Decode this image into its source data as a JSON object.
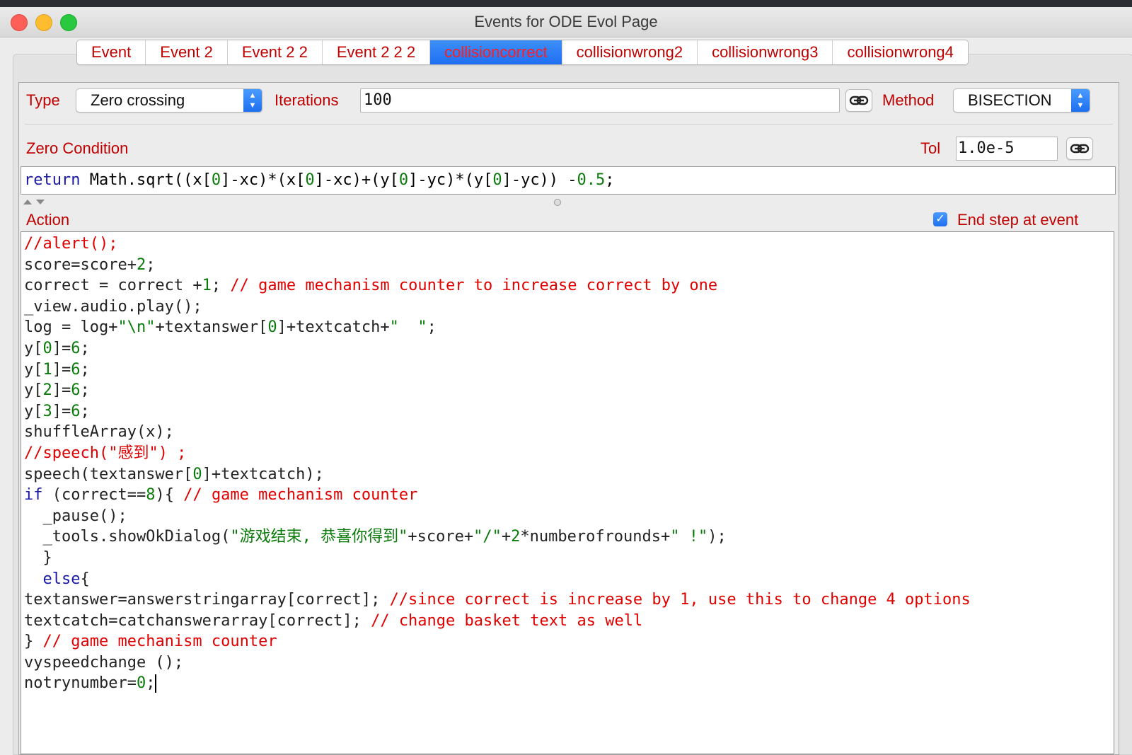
{
  "window": {
    "title": "Events for ODE Evol Page"
  },
  "tabs": [
    {
      "label": "Event",
      "active": false
    },
    {
      "label": "Event 2",
      "active": false
    },
    {
      "label": "Event 2 2",
      "active": false
    },
    {
      "label": "Event 2 2 2",
      "active": false
    },
    {
      "label": "collisioncorrect",
      "active": true
    },
    {
      "label": "collisionwrong2",
      "active": false
    },
    {
      "label": "collisionwrong3",
      "active": false
    },
    {
      "label": "collisionwrong4",
      "active": false
    }
  ],
  "form": {
    "type_label": "Type",
    "type_value": "Zero crossing",
    "iterations_label": "Iterations",
    "iterations_value": "100",
    "method_label": "Method",
    "method_value": "BISECTION",
    "zero_condition_label": "Zero Condition",
    "tol_label": "Tol",
    "tol_value": "1.0e-5",
    "zero_condition": {
      "keyword": "return",
      "p1": " Math.sqrt((x[",
      "n1": "0",
      "p2": "]-xc)*(x[",
      "n2": "0",
      "p3": "]-xc)+(y[",
      "n3": "0",
      "p4": "]-yc)*(y[",
      "n4": "0",
      "p5": "]-yc)) -",
      "n5": "0.5",
      "p6": ";"
    },
    "action_label": "Action",
    "end_step_label": "End step at event",
    "end_step_checked": true
  },
  "action_code": {
    "l1_c": "//alert();",
    "l2_a": "score=score+",
    "l2_n": "2",
    "l2_b": ";",
    "l3_a": "correct = correct +",
    "l3_n": "1",
    "l3_b": "; ",
    "l3_c": "// game mechanism counter to increase correct by one",
    "l4": "_view.audio.play();",
    "l5_a": "log = log+",
    "l5_s1": "\"\\n\"",
    "l5_b": "+textanswer[",
    "l5_n": "0",
    "l5_c": "]+textcatch+",
    "l5_s2": "\"  \"",
    "l5_d": ";",
    "l6_a": "y[",
    "l6_i": "0",
    "l6_b": "]=",
    "l6_v": "6",
    "l6_e": ";",
    "l7_a": "y[",
    "l7_i": "1",
    "l7_b": "]=",
    "l7_v": "6",
    "l7_e": ";",
    "l8_a": "y[",
    "l8_i": "2",
    "l8_b": "]=",
    "l8_v": "6",
    "l8_e": ";",
    "l9_a": "y[",
    "l9_i": "3",
    "l9_b": "]=",
    "l9_v": "6",
    "l9_e": ";",
    "l10": "shuffleArray(x);",
    "l11_c": "//speech(\"感到\") ;",
    "l12_a": "speech(textanswer[",
    "l12_n": "0",
    "l12_b": "]+textcatch);",
    "l13_k": "if",
    "l13_a": " (correct==",
    "l13_n": "8",
    "l13_b": "){ ",
    "l13_c": "// game mechanism counter",
    "l14": "  _pause();",
    "l15_a": "  _tools.showOkDialog(",
    "l15_s1": "\"游戏结束, 恭喜你得到\"",
    "l15_b": "+score+",
    "l15_s2": "\"/\"",
    "l15_c": "+",
    "l15_n": "2",
    "l15_d": "*numberofrounds+",
    "l15_s3": "\" !\"",
    "l15_e": ");",
    "l16": "  }",
    "l17_k": "  else",
    "l17_b": "{",
    "l18_a": "textanswer=answerstringarray[correct]; ",
    "l18_c": "//since correct is increase by 1, use this to change 4 options",
    "l19_a": "textcatch=catchanswerarray[correct]; ",
    "l19_c": "// change basket text as well",
    "l20_a": "} ",
    "l20_c": "// game mechanism counter",
    "l21": "vyspeedchange ();",
    "l22_a": "notrynumber=",
    "l22_n": "0",
    "l22_b": ";"
  }
}
